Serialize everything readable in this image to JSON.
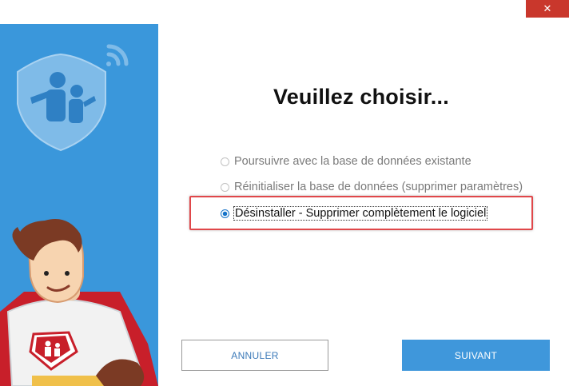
{
  "window": {
    "close_glyph": "✕"
  },
  "colors": {
    "sidebar": "#3a97db",
    "accent": "#1673c8",
    "highlight": "#e0474a",
    "next_button": "#3f97db"
  },
  "dialog": {
    "title": "Veuillez choisir...",
    "options": [
      {
        "label": "Poursuivre avec la base de données existante",
        "state": "disabled",
        "selected": false
      },
      {
        "label": "Réinitialiser la base de données (supprimer paramètres)",
        "state": "disabled",
        "selected": false
      },
      {
        "label": "Désinstaller - Supprimer complètement le logiciel",
        "state": "enabled",
        "selected": true
      }
    ]
  },
  "buttons": {
    "cancel": "ANNULER",
    "next": "SUIVANT"
  },
  "icons": [
    "shield-logo-icon",
    "wifi-signal-icon",
    "mascot-superhero",
    "close-icon"
  ]
}
